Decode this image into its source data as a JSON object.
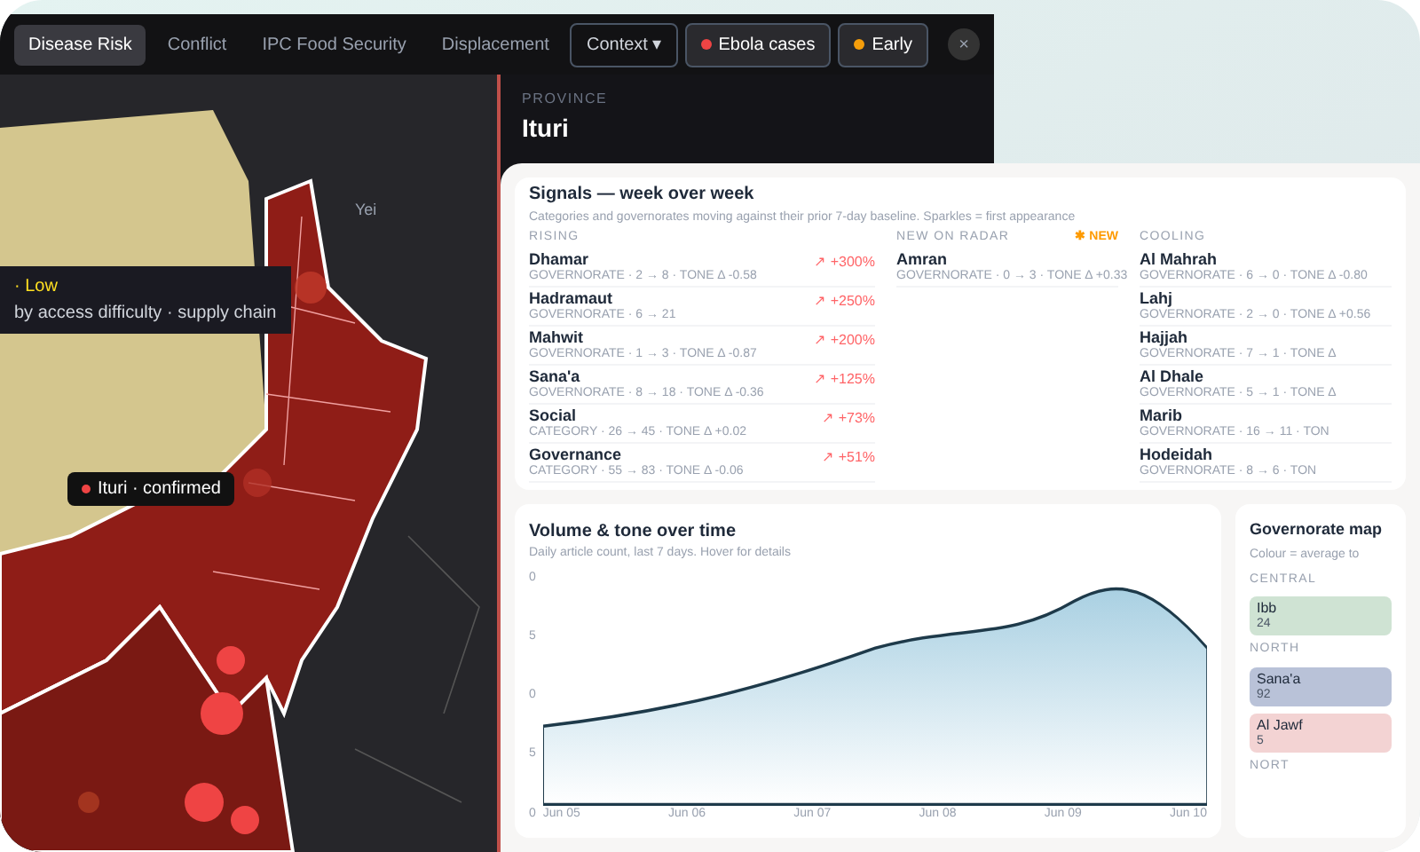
{
  "map_window": {
    "tabs": [
      {
        "label": "Disease Risk",
        "selected": true
      },
      {
        "label": "Conflict",
        "selected": false
      },
      {
        "label": "IPC Food Security",
        "selected": false
      },
      {
        "label": "Displacement",
        "selected": false
      },
      {
        "label": "Context ▾",
        "selected": false,
        "kind": "dropdown"
      }
    ],
    "layers": [
      {
        "label": "Ebola cases",
        "color": "#ef4444"
      },
      {
        "label": "Early",
        "color": "#f59e0b"
      }
    ],
    "close": "×",
    "map_labels": [
      "Yei"
    ],
    "legend": {
      "level": "· Low",
      "note": "by access difficulty · supply chain"
    },
    "tooltip": {
      "label": "Ituri · confirmed",
      "color": "#ef4444"
    },
    "province": {
      "caption": "PROVINCE",
      "name": "Ituri"
    }
  },
  "signals": {
    "title": "Signals — week over week",
    "subtitle": "Categories and governorates moving against their prior 7-day baseline. Sparkles = first appearance",
    "rising": {
      "heading": "RISING",
      "rows": [
        {
          "name": "Dhamar",
          "meta": "GOVERNORATE · 2 → 8 · TONE Δ -0.58",
          "delta": "↗ +300%"
        },
        {
          "name": "Hadramaut",
          "meta": "GOVERNORATE · 6 → 21",
          "delta": "↗ +250%"
        },
        {
          "name": "Mahwit",
          "meta": "GOVERNORATE · 1 → 3 · TONE Δ -0.87",
          "delta": "↗ +200%"
        },
        {
          "name": "Sana'a",
          "meta": "GOVERNORATE · 8 → 18 · TONE Δ -0.36",
          "delta": "↗ +125%"
        },
        {
          "name": "Social",
          "meta": "CATEGORY · 26 → 45 · TONE Δ +0.02",
          "delta": "↗ +73%"
        },
        {
          "name": "Governance",
          "meta": "CATEGORY · 55 → 83 · TONE Δ -0.06",
          "delta": "↗ +51%"
        }
      ]
    },
    "new_on_radar": {
      "heading": "NEW ON RADAR",
      "badge": "✱ NEW",
      "rows": [
        {
          "name": "Amran",
          "meta": "GOVERNORATE · 0 → 3 · TONE Δ +0.33"
        }
      ]
    },
    "cooling": {
      "heading": "COOLING",
      "rows": [
        {
          "name": "Al Mahrah",
          "meta": "GOVERNORATE · 6 → 0 · TONE Δ -0.80"
        },
        {
          "name": "Lahj",
          "meta": "GOVERNORATE · 2 → 0 · TONE Δ +0.56"
        },
        {
          "name": "Hajjah",
          "meta": "GOVERNORATE · 7 → 1 · TONE Δ"
        },
        {
          "name": "Al Dhale",
          "meta": "GOVERNORATE · 5 → 1 · TONE Δ"
        },
        {
          "name": "Marib",
          "meta": "GOVERNORATE · 16 → 11 · TON"
        },
        {
          "name": "Hodeidah",
          "meta": "GOVERNORATE · 8 → 6 · TON"
        }
      ]
    }
  },
  "volume_chart": {
    "title": "Volume & tone over time",
    "subtitle": "Daily article count, last 7 days. Hover for details",
    "y_labels": [
      "0",
      "5",
      "0",
      "5",
      "0"
    ],
    "x_labels": [
      "Jun 05",
      "Jun 06",
      "Jun 07",
      "Jun 08",
      "Jun 09",
      "Jun 10"
    ]
  },
  "governorate_map": {
    "title": "Governorate map",
    "subtitle": "Colour = average to",
    "groups": [
      {
        "heading": "CENTRAL",
        "tiles": [
          {
            "name": "Ibb",
            "value": "24",
            "color": "#cfe3d3"
          }
        ]
      },
      {
        "heading": "NORTH",
        "tiles": [
          {
            "name": "Sana'a",
            "value": "92",
            "color": "#b9c2d8"
          },
          {
            "name": "Al Jawf",
            "value": "5",
            "color": "#f3d3d3"
          }
        ]
      },
      {
        "heading": "NORT"
      }
    ]
  }
}
